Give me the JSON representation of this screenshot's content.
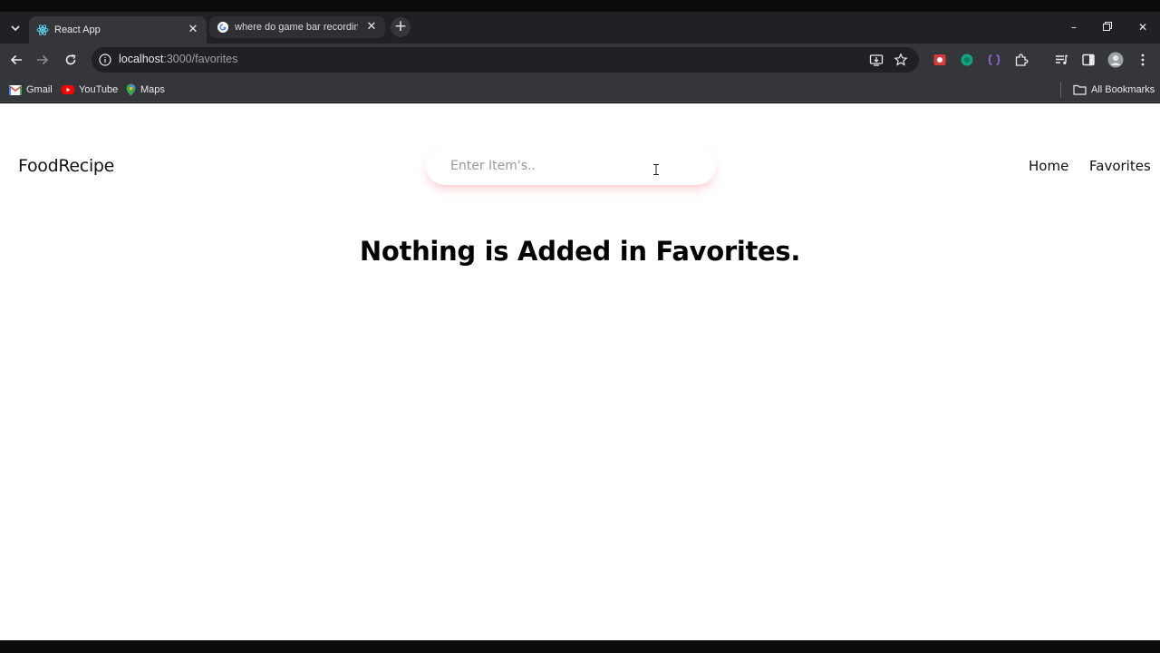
{
  "browser": {
    "tabs": [
      {
        "title": "React App",
        "icon": "react-icon",
        "active": true
      },
      {
        "title": "where do game bar recordings",
        "icon": "google-icon",
        "active": false
      }
    ],
    "address": {
      "host": "localhost",
      "path": ":3000/favorites"
    },
    "bookmarks": [
      {
        "label": "Gmail",
        "icon": "gmail-icon"
      },
      {
        "label": "YouTube",
        "icon": "youtube-icon"
      },
      {
        "label": "Maps",
        "icon": "maps-icon"
      }
    ],
    "all_bookmarks_label": "All Bookmarks"
  },
  "app": {
    "brand": "FoodRecipe",
    "search": {
      "placeholder": "Enter Item's..",
      "value": ""
    },
    "nav": [
      {
        "label": "Home"
      },
      {
        "label": "Favorites"
      }
    ],
    "empty_message": "Nothing is Added in Favorites."
  },
  "colors": {
    "chrome_dark": "#202124",
    "chrome_toolbar": "#35363a",
    "search_shadow": "#f4a0aa",
    "page_bg": "#ffffff"
  }
}
